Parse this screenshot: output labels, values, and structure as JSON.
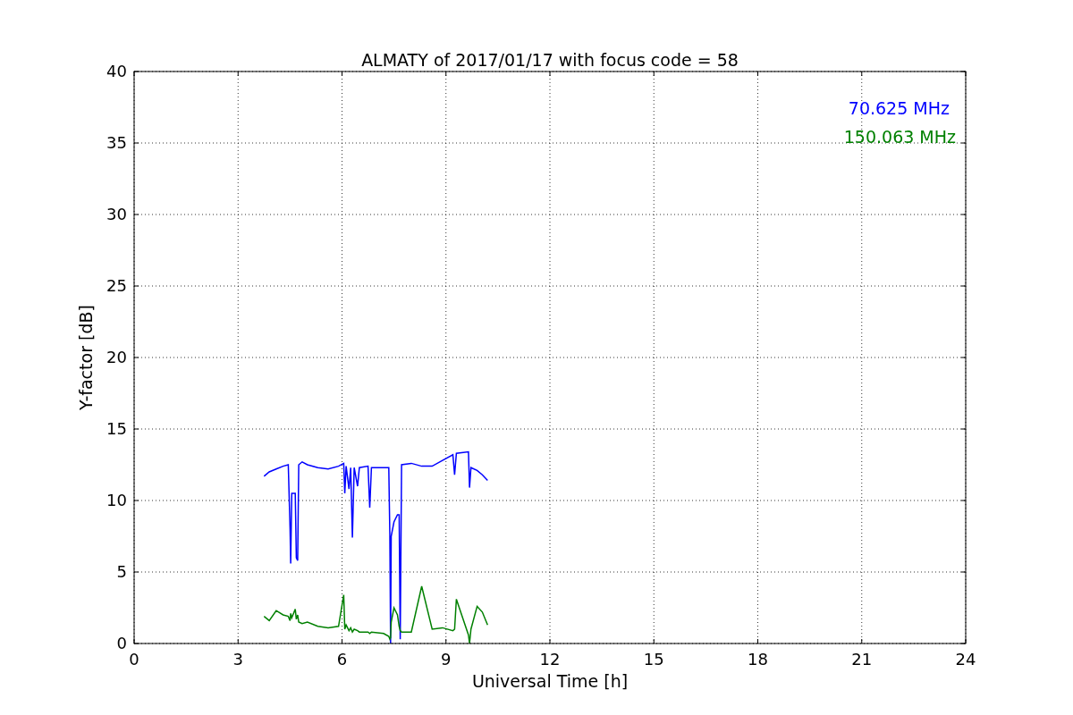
{
  "chart_data": {
    "type": "line",
    "title": "ALMATY of 2017/01/17 with focus code = 58",
    "xlabel": "Universal Time [h]",
    "ylabel": "Y-factor [dB]",
    "x": [
      3.75,
      3.9,
      4.1,
      4.3,
      4.45,
      4.5,
      4.52,
      4.55,
      4.65,
      4.68,
      4.72,
      4.75,
      4.85,
      5.0,
      5.3,
      5.6,
      5.9,
      6.05,
      6.08,
      6.12,
      6.2,
      6.25,
      6.3,
      6.35,
      6.45,
      6.5,
      6.75,
      6.8,
      6.85,
      7.2,
      7.35,
      7.38,
      7.4,
      7.42,
      7.5,
      7.6,
      7.65,
      7.68,
      7.72,
      8.0,
      8.3,
      8.6,
      8.9,
      9.2,
      9.25,
      9.3,
      9.65,
      9.68,
      9.72,
      9.9,
      10.05,
      10.2
    ],
    "series": [
      {
        "name": "70.625 MHz",
        "color": "#0000ff",
        "values": [
          11.7,
          12.0,
          12.2,
          12.4,
          12.5,
          8,
          5.6,
          10.5,
          10.5,
          6,
          5.8,
          12.5,
          12.7,
          12.5,
          12.3,
          12.2,
          12.4,
          12.6,
          10.5,
          12.4,
          10.8,
          12.3,
          7.4,
          12.3,
          11.0,
          12.3,
          12.4,
          9.5,
          12.3,
          12.3,
          12.3,
          7.5,
          0,
          7.5,
          8.5,
          9.0,
          9.0,
          0.3,
          12.5,
          12.6,
          12.4,
          12.4,
          12.8,
          13.2,
          11.8,
          13.3,
          13.4,
          10.9,
          12.3,
          12.1,
          11.8,
          11.4
        ]
      },
      {
        "name": "150.063 MHz",
        "color": "#008000",
        "values": [
          1.9,
          1.6,
          2.3,
          2.0,
          1.9,
          1.6,
          2.1,
          1.8,
          2.4,
          1.7,
          2.0,
          1.5,
          1.4,
          1.5,
          1.2,
          1.1,
          1.2,
          3.4,
          1.0,
          1.3,
          0.9,
          1.1,
          0.8,
          1.0,
          0.9,
          0.8,
          0.8,
          0.7,
          0.8,
          0.7,
          0.5,
          0.3,
          0.4,
          1.5,
          2.5,
          2.0,
          1.2,
          0.9,
          0.8,
          0.8,
          4.0,
          1.0,
          1.1,
          0.9,
          1.0,
          3.1,
          0.6,
          0.0,
          1.0,
          2.6,
          2.2,
          1.3
        ]
      }
    ],
    "grid": true,
    "xlim": [
      0,
      24
    ],
    "ylim": [
      0,
      40
    ],
    "xticks": [
      0,
      3,
      6,
      9,
      12,
      15,
      18,
      21,
      24
    ],
    "yticks": [
      0,
      5,
      10,
      15,
      20,
      25,
      30,
      35,
      40
    ]
  }
}
